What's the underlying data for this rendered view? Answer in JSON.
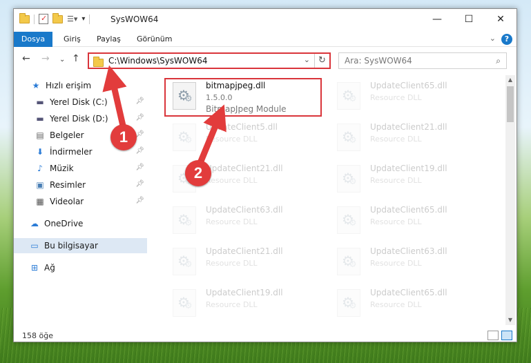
{
  "window": {
    "title": "SysWOW64"
  },
  "ribbon": {
    "tabs": [
      {
        "label": "Dosya",
        "active": true
      },
      {
        "label": "Giriş"
      },
      {
        "label": "Paylaş"
      },
      {
        "label": "Görünüm"
      }
    ],
    "help": "?"
  },
  "nav": {
    "address": "C:\\Windows\\SysWOW64",
    "search_placeholder": "Ara: SysWOW64"
  },
  "sidebar": {
    "items": [
      {
        "label": "Hızlı erişim",
        "icon": "star-icon"
      },
      {
        "label": "Yerel Disk (C:)",
        "icon": "drive-icon",
        "pinned": true
      },
      {
        "label": "Yerel Disk (D:)",
        "icon": "drive-icon",
        "pinned": true
      },
      {
        "label": "Belgeler",
        "icon": "documents-icon",
        "pinned": true
      },
      {
        "label": "İndirmeler",
        "icon": "download-icon",
        "pinned": true
      },
      {
        "label": "Müzik",
        "icon": "music-icon",
        "pinned": true
      },
      {
        "label": "Resimler",
        "icon": "pictures-icon",
        "pinned": true
      },
      {
        "label": "Videolar",
        "icon": "videos-icon",
        "pinned": true
      },
      {
        "label": "OneDrive",
        "icon": "cloud-icon"
      },
      {
        "label": "Bu bilgisayar",
        "icon": "computer-icon",
        "selected": true
      },
      {
        "label": "Ağ",
        "icon": "network-icon"
      }
    ]
  },
  "files": {
    "highlighted": {
      "name": "bitmapjpeg.dll",
      "line1": "1.5.0.0",
      "line2": "BitmapJpeg Module"
    },
    "others": [
      {
        "name": "UpdateClient5.dll",
        "type": "Resource DLL"
      },
      {
        "name": "UpdateClient21.dll",
        "type": "Resource DLL"
      },
      {
        "name": "UpdateClient63.dll",
        "type": "Resource DLL"
      },
      {
        "name": "UpdateClient21.dll",
        "type": "Resource DLL"
      },
      {
        "name": "UpdateClient19.dll",
        "type": "Resource DLL"
      },
      {
        "name": "UpdateClient65.dll",
        "type": "Resource DLL"
      },
      {
        "name": "UpdateClient21.dll",
        "type": "Resource DLL"
      },
      {
        "name": "UpdateClient19.dll",
        "type": "Resource DLL"
      },
      {
        "name": "UpdateClient65.dll",
        "type": "Resource DLL"
      },
      {
        "name": "UpdateClient63.dll",
        "type": "Resource DLL"
      },
      {
        "name": "UpdateClient65.dll",
        "type": "Resource DLL"
      }
    ]
  },
  "status": {
    "count": "158 öğe"
  },
  "callouts": {
    "one": "1",
    "two": "2"
  },
  "colors": {
    "accent": "#1979ca",
    "highlight": "#d9343a"
  }
}
